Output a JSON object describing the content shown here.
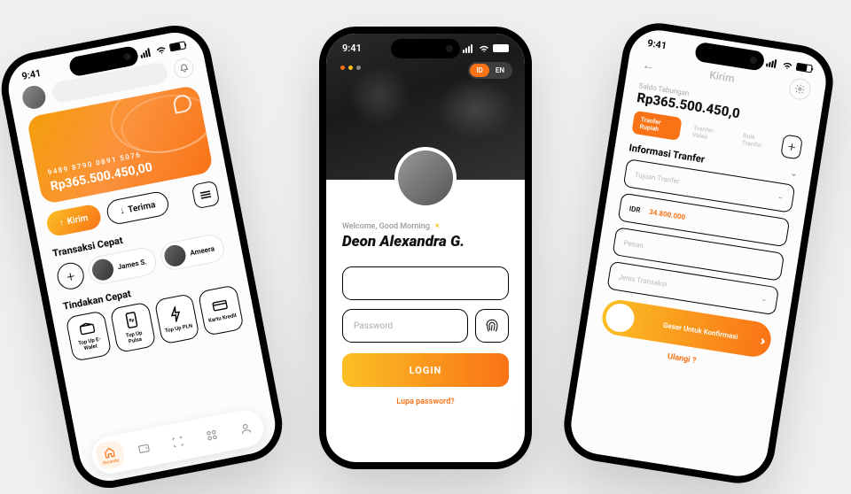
{
  "status_time": "9:41",
  "phone1": {
    "card_number": "9489  8790  0891  5076",
    "balance": "Rp365.500.450,00",
    "send_label": "Kirim",
    "receive_label": "Terima",
    "quick_tx_header": "Transaksi Cepat",
    "contacts": [
      {
        "name": "James S."
      },
      {
        "name": "Ameera"
      }
    ],
    "quick_action_header": "Tindakan Cepat",
    "tiles": [
      {
        "icon": "wallet",
        "label": "Top Up E-Walet"
      },
      {
        "icon": "rp",
        "label": "Top Up Pulsa"
      },
      {
        "icon": "bolt",
        "label": "Top Up PLN"
      },
      {
        "icon": "card",
        "label": "Kartu Kredit"
      }
    ],
    "nav_home": "Beranda"
  },
  "phone2": {
    "lang_active": "ID",
    "lang_other": "EN",
    "greeting": "Welcome, Good Morning",
    "username": "Deon Alexandra G.",
    "password_placeholder": "Password",
    "login_label": "LOGIN",
    "forgot_label": "Lupa password?"
  },
  "phone3": {
    "title": "Kirim",
    "saldo_label": "Saldo Tabungan",
    "saldo_value": "Rp365.500.450,0",
    "tabs": [
      {
        "label": "Tranfer Rupiah",
        "active": true
      },
      {
        "label": "Tranfer Valas",
        "active": false
      },
      {
        "label": "Bulk Tranfer",
        "active": false
      }
    ],
    "info_header": "Informasi Tranfer",
    "fields": {
      "tujuan_placeholder": "Tujuan Tranfer",
      "currency": "IDR",
      "amount": "34.800.000",
      "pesan_placeholder": "Pesan",
      "jenis_placeholder": "Jenis Transaksi"
    },
    "slide_label": "Geser Untuk Konfirmasi",
    "repeat_label": "Ulangi ?"
  }
}
